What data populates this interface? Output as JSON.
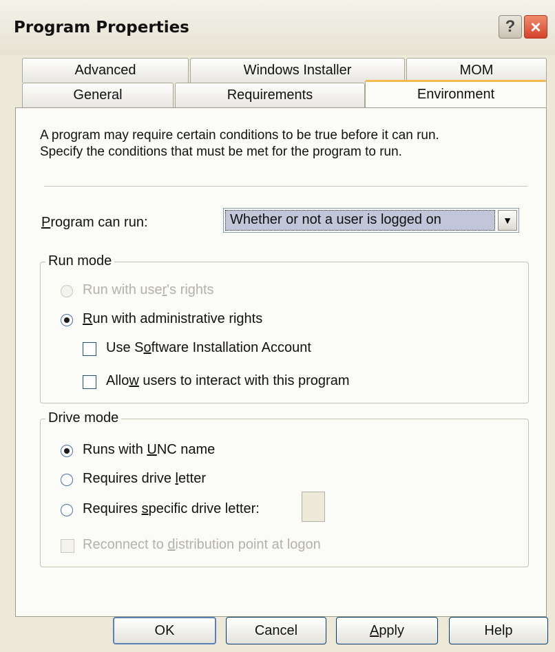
{
  "window": {
    "title": "Program Properties",
    "help_glyph": "?",
    "close_glyph": "×"
  },
  "tabs": {
    "row1": [
      "Advanced",
      "Windows Installer",
      "MOM"
    ],
    "row2": [
      "General",
      "Requirements",
      "Environment"
    ],
    "active": "Environment"
  },
  "description": {
    "line1": "A program may require certain conditions to be true before it can run.",
    "line2": "Specify the conditions that must be met for the program to run."
  },
  "program_can_run": {
    "label_prefix": "",
    "label_underlined": "P",
    "label_suffix": "rogram can run:",
    "value": "Whether or not a user is logged on"
  },
  "run_mode": {
    "legend": "Run mode",
    "run_with_user_rights": {
      "prefix": "Run with use",
      "u": "r",
      "suffix": "'s rights",
      "checked": false,
      "disabled": true
    },
    "run_with_admin_rights": {
      "prefix": "",
      "u": "R",
      "suffix": "un with administrative rights",
      "checked": true,
      "disabled": false
    },
    "use_software_installation_account": {
      "prefix": "Use S",
      "u": "o",
      "suffix": "ftware Installation Account",
      "checked": false
    },
    "allow_users_interact": {
      "prefix": "Allo",
      "u": "w",
      "suffix": " users to interact with this program",
      "checked": false
    }
  },
  "drive_mode": {
    "legend": "Drive mode",
    "runs_with_unc": {
      "prefix": "Runs with ",
      "u": "U",
      "suffix": "NC name",
      "checked": true
    },
    "requires_drive_letter": {
      "prefix": "Requires drive ",
      "u": "l",
      "suffix": "etter",
      "checked": false
    },
    "requires_specific_drive_letter": {
      "prefix": "Requires ",
      "u": "s",
      "suffix": "pecific drive letter:",
      "checked": false
    },
    "reconnect": {
      "prefix": "Reconnect to ",
      "u": "d",
      "suffix": "istribution point at logon",
      "checked": false,
      "disabled": true
    }
  },
  "buttons": {
    "ok": "OK",
    "cancel": "Cancel",
    "apply_u": "A",
    "apply_rest": "pply",
    "help": "Help"
  }
}
